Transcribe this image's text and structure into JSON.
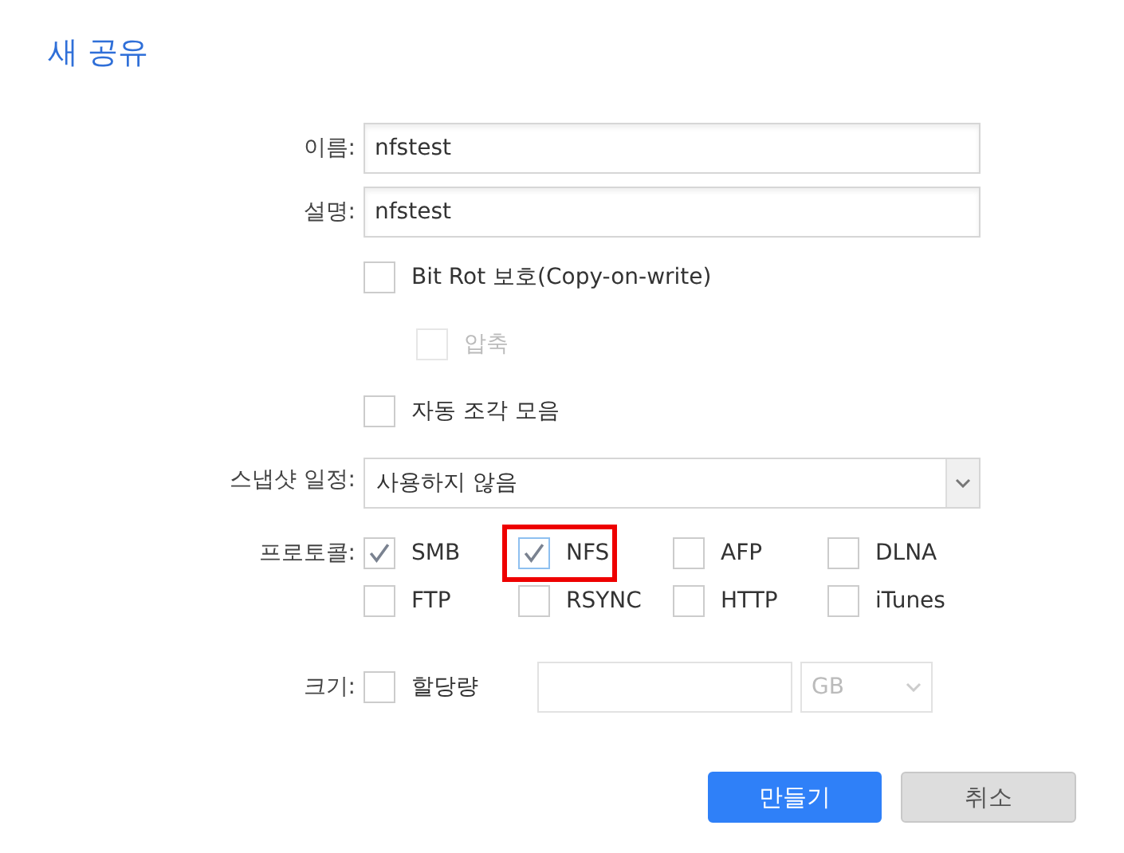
{
  "title": "새 공유",
  "name": {
    "label": "이름:",
    "value": "nfstest"
  },
  "description": {
    "label": "설명:",
    "value": "nfstest"
  },
  "options": [
    {
      "label": "Bit Rot 보호(Copy-on-write)",
      "checked": false,
      "disabled": false,
      "nested": false
    },
    {
      "label": "압축",
      "checked": false,
      "disabled": true,
      "nested": true
    },
    {
      "label": "자동 조각 모음",
      "checked": false,
      "disabled": false,
      "nested": false
    }
  ],
  "snapshot": {
    "label": "스냅샷 일정:",
    "value": "사용하지 않음"
  },
  "protocols": {
    "label": "프로토콜:",
    "items": [
      {
        "label": "SMB",
        "checked": true,
        "highlighted": false
      },
      {
        "label": "NFS",
        "checked": true,
        "highlighted": true
      },
      {
        "label": "AFP",
        "checked": false,
        "highlighted": false
      },
      {
        "label": "DLNA",
        "checked": false,
        "highlighted": false
      },
      {
        "label": "FTP",
        "checked": false,
        "highlighted": false
      },
      {
        "label": "RSYNC",
        "checked": false,
        "highlighted": false
      },
      {
        "label": "HTTP",
        "checked": false,
        "highlighted": false
      },
      {
        "label": "iTunes",
        "checked": false,
        "highlighted": false
      }
    ]
  },
  "size": {
    "label": "크기:",
    "quota_label": "할당량",
    "quota_checked": false,
    "unit": "GB"
  },
  "buttons": [
    {
      "label": "만들기",
      "kind": "primary"
    },
    {
      "label": "취소",
      "kind": "secondary"
    }
  ]
}
